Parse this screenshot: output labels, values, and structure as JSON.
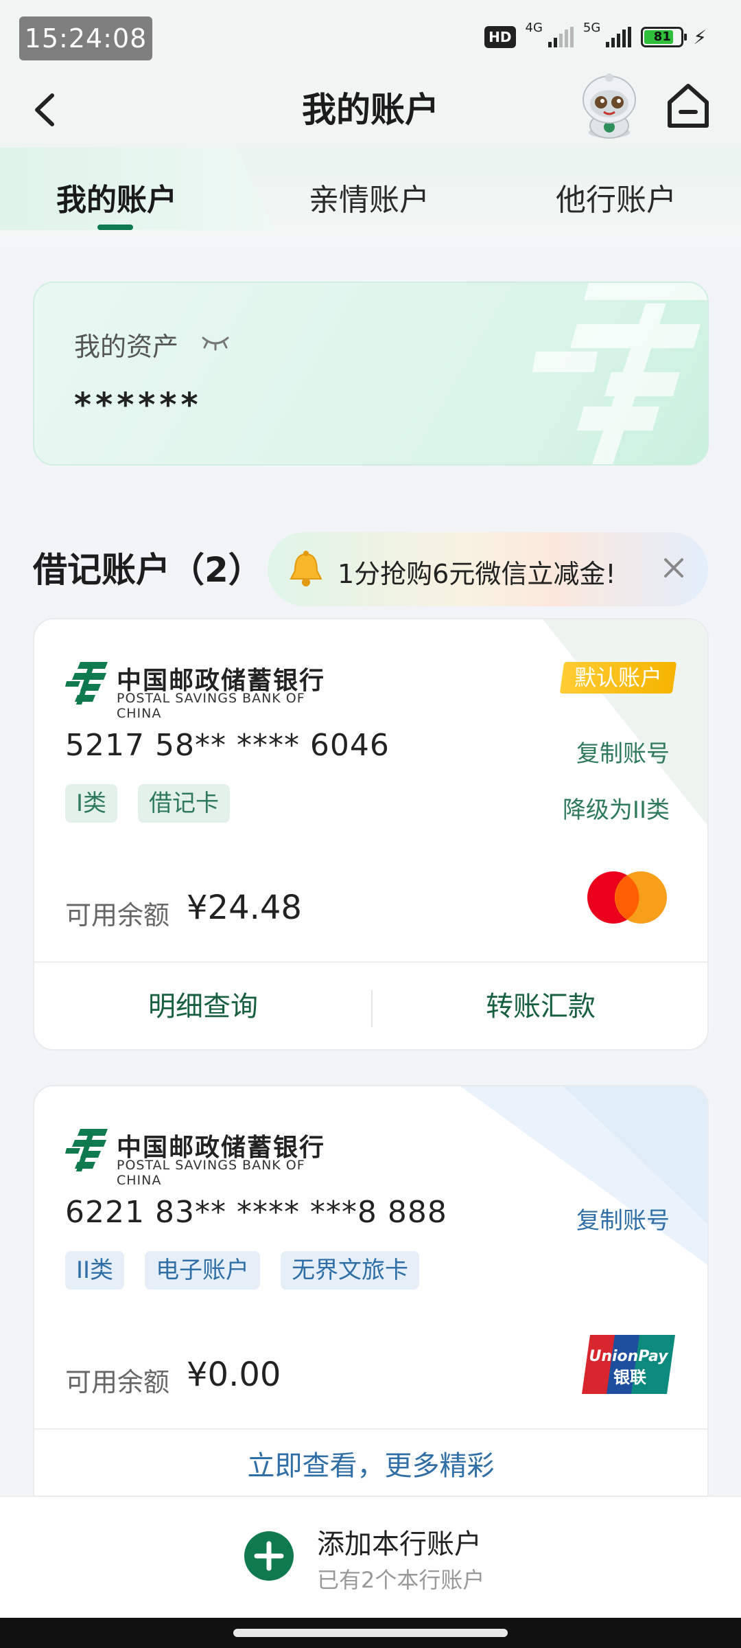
{
  "status_bar": {
    "time": "15:24:08",
    "hd_label": "HD",
    "net1": "4G",
    "net2": "5G",
    "battery": "81",
    "battery_level": 0.81
  },
  "nav": {
    "title": "我的账户"
  },
  "tabs": [
    {
      "label": "我的账户",
      "active": true
    },
    {
      "label": "亲情账户",
      "active": false
    },
    {
      "label": "他行账户",
      "active": false
    }
  ],
  "assets": {
    "label": "我的资产",
    "value": "******"
  },
  "debit_section": {
    "title": "借记账户（2）",
    "promo_text": "1分抢购6元微信立减金!"
  },
  "bank": {
    "name_cn": "中国邮政储蓄银行",
    "name_en": "POSTAL SAVINGS BANK OF CHINA"
  },
  "accounts": [
    {
      "number": "5217 58** **** 6046",
      "default_badge": "默认账户",
      "copy_label": "复制账号",
      "downgrade_label": "降级为II类",
      "tags": [
        "I类",
        "借记卡"
      ],
      "balance_label": "可用余额",
      "balance": "¥24.48",
      "card_network": "mastercard",
      "actions": [
        "明细查询",
        "转账汇款"
      ]
    },
    {
      "number": "6221 83** **** ***8 888",
      "copy_label": "复制账号",
      "tags": [
        "II类",
        "电子账户",
        "无界文旅卡"
      ],
      "balance_label": "可用余额",
      "balance": "¥0.00",
      "card_network": "unionpay",
      "unionpay_text1": "UnionPay",
      "unionpay_text2": "银联",
      "more_label": "立即查看，更多精彩"
    }
  ],
  "bottom": {
    "add_title": "添加本行账户",
    "add_sub": "已有2个本行账户"
  },
  "colors": {
    "brand_green": "#0e7a4d",
    "link_blue": "#2f6fa6",
    "badge_yellow": "#f5b400"
  }
}
